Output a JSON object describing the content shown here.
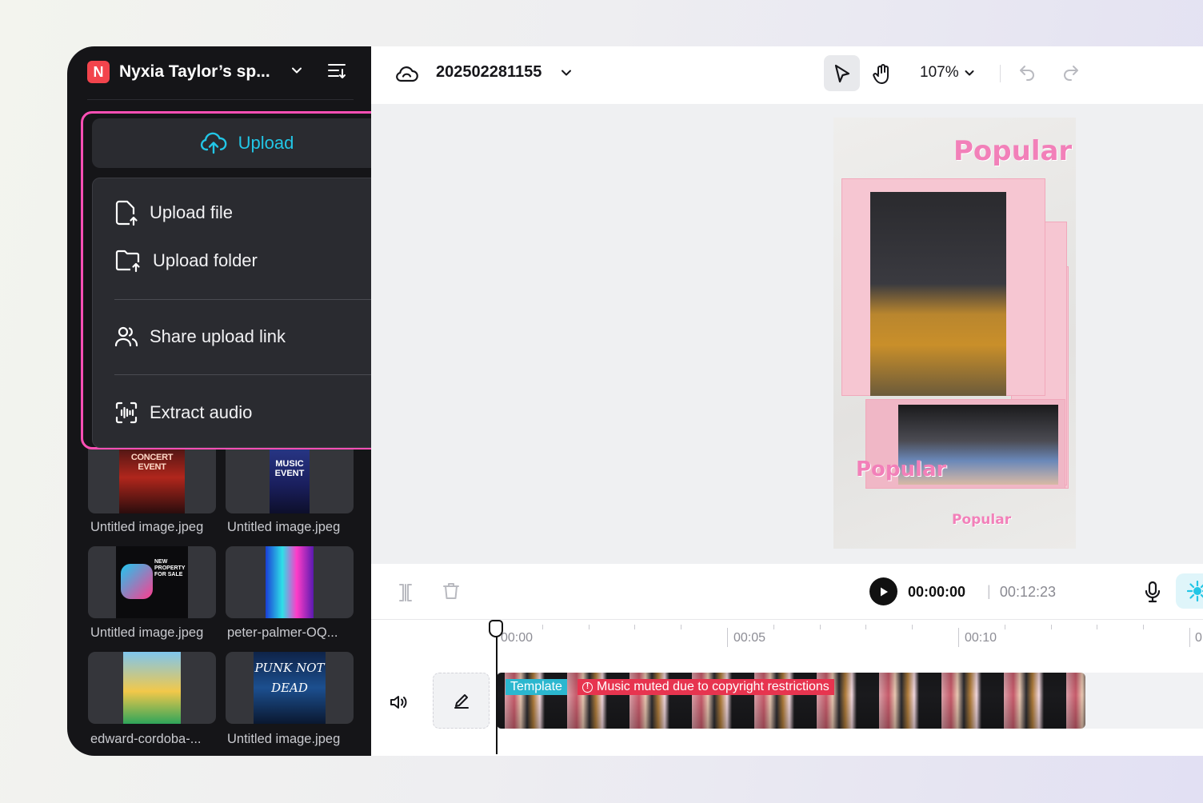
{
  "workspace": {
    "initial": "N",
    "name": "Nyxia Taylor’s sp...",
    "brand_color": "#f2444c"
  },
  "upload_popup": {
    "upload_label": "Upload",
    "menu": {
      "upload_file": "Upload file",
      "upload_folder": "Upload folder",
      "share_link": "Share upload link",
      "extract_audio": "Extract audio"
    },
    "highlight_color": "#ff4fb5",
    "accent_color": "#22c6e6"
  },
  "media": [
    {
      "caption": "Untitled image.jpeg",
      "art_text": "CONCERT EVENT"
    },
    {
      "caption": "Untitled image.jpeg",
      "art_text": "MUSIC EVENT"
    },
    {
      "caption": "Untitled image.jpeg",
      "art_text": "NEW PROPERTY FOR SALE"
    },
    {
      "caption": "peter-palmer-OQ...",
      "art_text": ""
    },
    {
      "caption": "edward-cordoba-...",
      "art_text": ""
    },
    {
      "caption": "Untitled image.jpeg",
      "art_text": "PUNK NOT DEAD"
    }
  ],
  "topbar": {
    "project_name": "202502281155",
    "zoom": "107%"
  },
  "poster": {
    "title_top": "Popular",
    "title_mid": "Popular",
    "title_bottom": "Popular"
  },
  "playback": {
    "current_time": "00:00:00",
    "separator": "|",
    "total_time": "00:12:23"
  },
  "timeline": {
    "ruler": [
      "00:00",
      "00:05",
      "00:10",
      "0"
    ],
    "clip_tag": "Template",
    "clip_warning": "Music muted due to copyright restrictions"
  }
}
